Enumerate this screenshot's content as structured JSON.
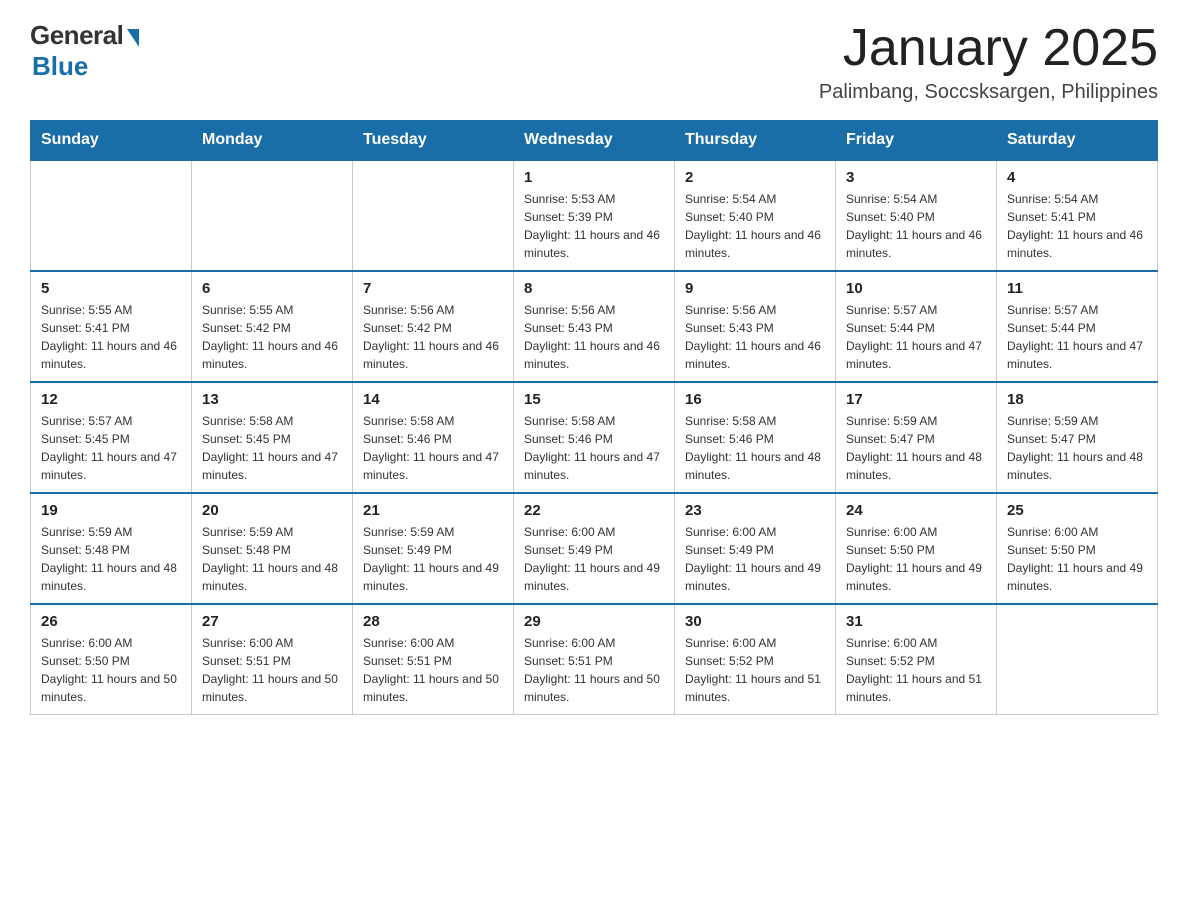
{
  "header": {
    "logo": {
      "general": "General",
      "blue": "Blue"
    },
    "title": "January 2025",
    "subtitle": "Palimbang, Soccsksargen, Philippines"
  },
  "days_of_week": [
    "Sunday",
    "Monday",
    "Tuesday",
    "Wednesday",
    "Thursday",
    "Friday",
    "Saturday"
  ],
  "weeks": [
    [
      {
        "day": "",
        "info": ""
      },
      {
        "day": "",
        "info": ""
      },
      {
        "day": "",
        "info": ""
      },
      {
        "day": "1",
        "info": "Sunrise: 5:53 AM\nSunset: 5:39 PM\nDaylight: 11 hours and 46 minutes."
      },
      {
        "day": "2",
        "info": "Sunrise: 5:54 AM\nSunset: 5:40 PM\nDaylight: 11 hours and 46 minutes."
      },
      {
        "day": "3",
        "info": "Sunrise: 5:54 AM\nSunset: 5:40 PM\nDaylight: 11 hours and 46 minutes."
      },
      {
        "day": "4",
        "info": "Sunrise: 5:54 AM\nSunset: 5:41 PM\nDaylight: 11 hours and 46 minutes."
      }
    ],
    [
      {
        "day": "5",
        "info": "Sunrise: 5:55 AM\nSunset: 5:41 PM\nDaylight: 11 hours and 46 minutes."
      },
      {
        "day": "6",
        "info": "Sunrise: 5:55 AM\nSunset: 5:42 PM\nDaylight: 11 hours and 46 minutes."
      },
      {
        "day": "7",
        "info": "Sunrise: 5:56 AM\nSunset: 5:42 PM\nDaylight: 11 hours and 46 minutes."
      },
      {
        "day": "8",
        "info": "Sunrise: 5:56 AM\nSunset: 5:43 PM\nDaylight: 11 hours and 46 minutes."
      },
      {
        "day": "9",
        "info": "Sunrise: 5:56 AM\nSunset: 5:43 PM\nDaylight: 11 hours and 46 minutes."
      },
      {
        "day": "10",
        "info": "Sunrise: 5:57 AM\nSunset: 5:44 PM\nDaylight: 11 hours and 47 minutes."
      },
      {
        "day": "11",
        "info": "Sunrise: 5:57 AM\nSunset: 5:44 PM\nDaylight: 11 hours and 47 minutes."
      }
    ],
    [
      {
        "day": "12",
        "info": "Sunrise: 5:57 AM\nSunset: 5:45 PM\nDaylight: 11 hours and 47 minutes."
      },
      {
        "day": "13",
        "info": "Sunrise: 5:58 AM\nSunset: 5:45 PM\nDaylight: 11 hours and 47 minutes."
      },
      {
        "day": "14",
        "info": "Sunrise: 5:58 AM\nSunset: 5:46 PM\nDaylight: 11 hours and 47 minutes."
      },
      {
        "day": "15",
        "info": "Sunrise: 5:58 AM\nSunset: 5:46 PM\nDaylight: 11 hours and 47 minutes."
      },
      {
        "day": "16",
        "info": "Sunrise: 5:58 AM\nSunset: 5:46 PM\nDaylight: 11 hours and 48 minutes."
      },
      {
        "day": "17",
        "info": "Sunrise: 5:59 AM\nSunset: 5:47 PM\nDaylight: 11 hours and 48 minutes."
      },
      {
        "day": "18",
        "info": "Sunrise: 5:59 AM\nSunset: 5:47 PM\nDaylight: 11 hours and 48 minutes."
      }
    ],
    [
      {
        "day": "19",
        "info": "Sunrise: 5:59 AM\nSunset: 5:48 PM\nDaylight: 11 hours and 48 minutes."
      },
      {
        "day": "20",
        "info": "Sunrise: 5:59 AM\nSunset: 5:48 PM\nDaylight: 11 hours and 48 minutes."
      },
      {
        "day": "21",
        "info": "Sunrise: 5:59 AM\nSunset: 5:49 PM\nDaylight: 11 hours and 49 minutes."
      },
      {
        "day": "22",
        "info": "Sunrise: 6:00 AM\nSunset: 5:49 PM\nDaylight: 11 hours and 49 minutes."
      },
      {
        "day": "23",
        "info": "Sunrise: 6:00 AM\nSunset: 5:49 PM\nDaylight: 11 hours and 49 minutes."
      },
      {
        "day": "24",
        "info": "Sunrise: 6:00 AM\nSunset: 5:50 PM\nDaylight: 11 hours and 49 minutes."
      },
      {
        "day": "25",
        "info": "Sunrise: 6:00 AM\nSunset: 5:50 PM\nDaylight: 11 hours and 49 minutes."
      }
    ],
    [
      {
        "day": "26",
        "info": "Sunrise: 6:00 AM\nSunset: 5:50 PM\nDaylight: 11 hours and 50 minutes."
      },
      {
        "day": "27",
        "info": "Sunrise: 6:00 AM\nSunset: 5:51 PM\nDaylight: 11 hours and 50 minutes."
      },
      {
        "day": "28",
        "info": "Sunrise: 6:00 AM\nSunset: 5:51 PM\nDaylight: 11 hours and 50 minutes."
      },
      {
        "day": "29",
        "info": "Sunrise: 6:00 AM\nSunset: 5:51 PM\nDaylight: 11 hours and 50 minutes."
      },
      {
        "day": "30",
        "info": "Sunrise: 6:00 AM\nSunset: 5:52 PM\nDaylight: 11 hours and 51 minutes."
      },
      {
        "day": "31",
        "info": "Sunrise: 6:00 AM\nSunset: 5:52 PM\nDaylight: 11 hours and 51 minutes."
      },
      {
        "day": "",
        "info": ""
      }
    ]
  ]
}
